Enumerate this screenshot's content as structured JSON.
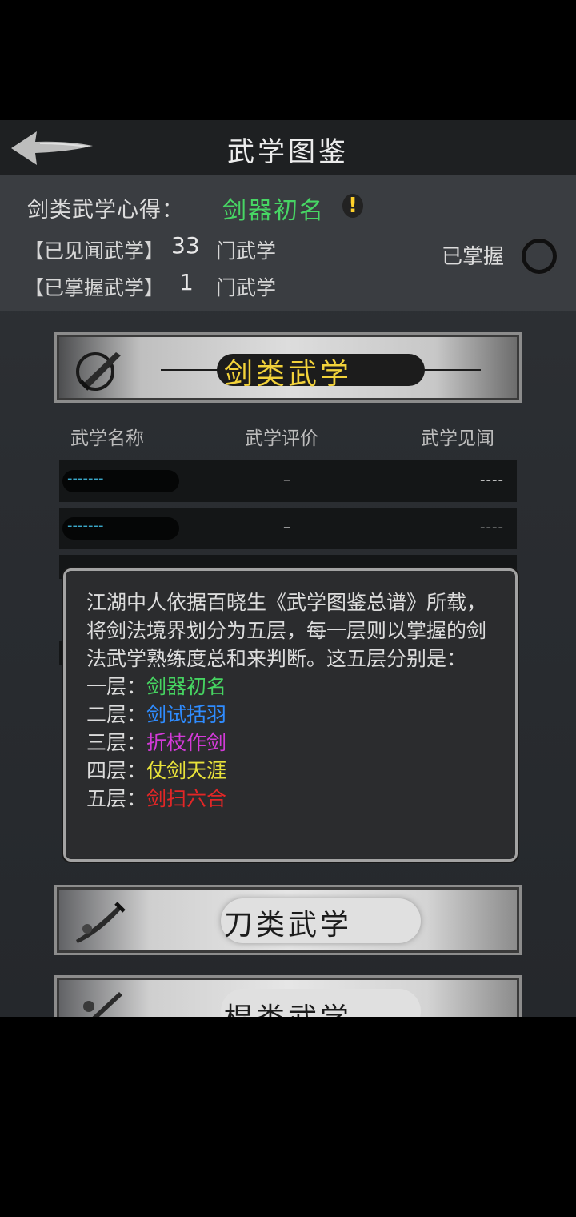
{
  "header": {
    "title": "武学图鉴"
  },
  "info": {
    "insight_label": "剑类武学心得：",
    "insight_value": "剑器初名",
    "alert_glyph": "!",
    "seen_prefix": "【已见闻武学】",
    "seen_count": "33",
    "seen_unit": "门武学",
    "mastered_prefix": "【已掌握武学】",
    "mastered_count": "1",
    "mastered_unit": "门武学",
    "mastered_filter_label": "已掌握"
  },
  "categories": [
    {
      "label": "剑类武学"
    },
    {
      "label": "刀类武学"
    },
    {
      "label": "棍类武学"
    }
  ],
  "table": {
    "headers": [
      "武学名称",
      "武学评价",
      "武学见闻"
    ],
    "rows": [
      {
        "name": "-------",
        "rating": "–",
        "seen": "----"
      },
      {
        "name": "-------",
        "rating": "–",
        "seen": "----"
      }
    ]
  },
  "tooltip": {
    "text": "江湖中人依据百晓生《武学图鉴总谱》所载，将剑法境界划分为五层，每一层则以掌握的剑法武学熟练度总和来判断。这五层分别是：",
    "tiers": [
      {
        "prefix": "一层：",
        "name": "剑器初名",
        "color": "#46d461"
      },
      {
        "prefix": "二层：",
        "name": "剑试括羽",
        "color": "#2f8cff"
      },
      {
        "prefix": "三层：",
        "name": "折枝作剑",
        "color": "#d33ad8"
      },
      {
        "prefix": "四层：",
        "name": "仗剑天涯",
        "color": "#e8e23a"
      },
      {
        "prefix": "五层：",
        "name": "剑扫六合",
        "color": "#e32626"
      }
    ]
  },
  "icons": {
    "back": "back-arrow-icon",
    "sword": "sword-icon",
    "blade": "blade-icon",
    "staff": "staff-icon",
    "toggle": "empty-circle-icon"
  }
}
